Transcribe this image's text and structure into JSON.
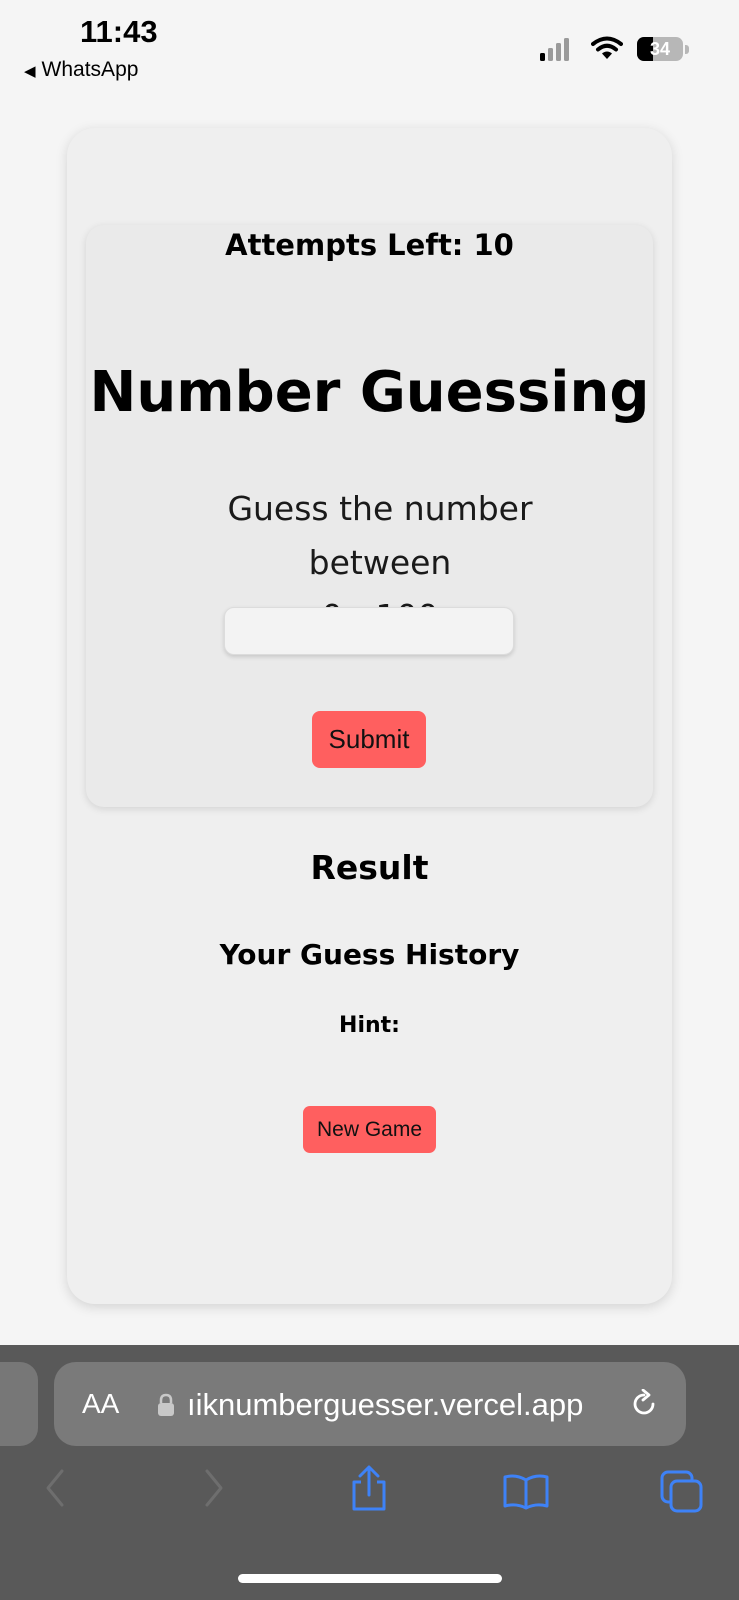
{
  "status_bar": {
    "time": "11:43",
    "back_app": "WhatsApp",
    "battery_level": "34",
    "icons": [
      "cellular-signal-icon",
      "wifi-icon",
      "battery-icon"
    ]
  },
  "game": {
    "attempts_label": "Attempts Left: 10",
    "title": "Number Guessing",
    "instruction_line1": "Guess the number between",
    "instruction_line2": "0 - 100",
    "input_value": "",
    "submit_label": "Submit",
    "result_heading": "Result",
    "history_heading": "Your Guess History",
    "hint_label": "Hint:",
    "new_game_label": "New Game"
  },
  "browser": {
    "text_size_button": "AA",
    "url": "ıiknumberguesser.vercel.app",
    "icons": [
      "back-icon",
      "forward-icon",
      "share-icon",
      "bookmarks-icon",
      "tabs-icon",
      "lock-icon",
      "reload-icon"
    ]
  },
  "colors": {
    "accent_button": "#ff5f5f",
    "page_background": "#f5f5f5",
    "card_background": "#efefef",
    "browser_toolbar": "#595959",
    "ios_blue": "#3e82f7"
  }
}
